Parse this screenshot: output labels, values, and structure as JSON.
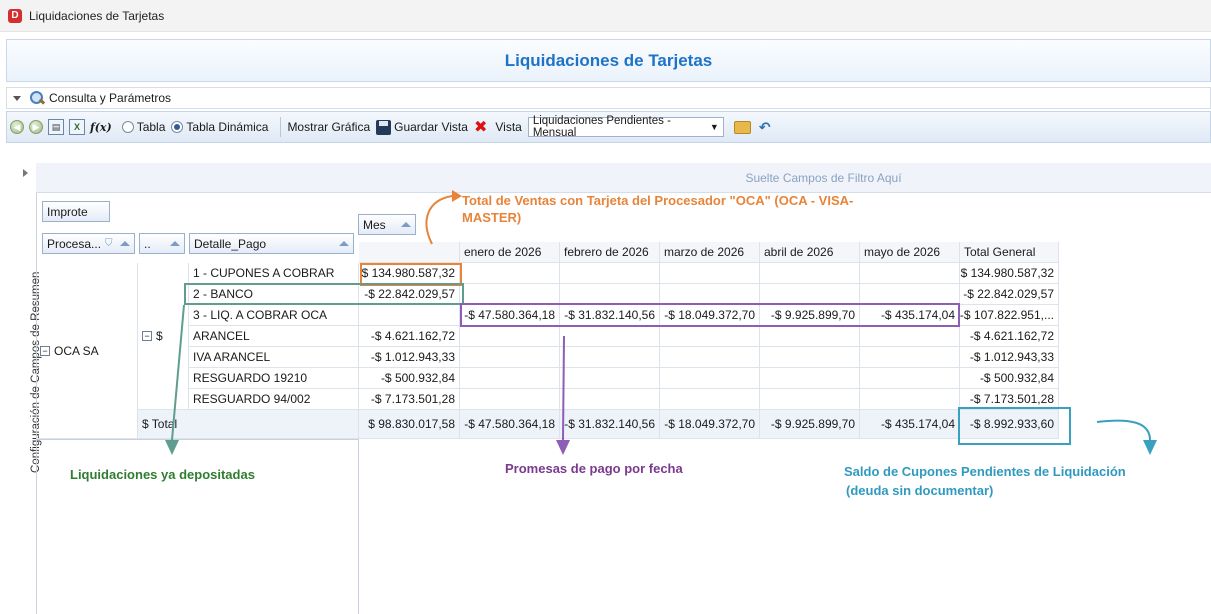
{
  "window": {
    "title": "Liquidaciones de Tarjetas",
    "icon_letter": "D"
  },
  "banner": {
    "title": "Liquidaciones de Tarjetas"
  },
  "consulta": {
    "label": "Consulta y Parámetros"
  },
  "toolbar": {
    "radio_tabla": "Tabla",
    "radio_dinamica": "Tabla Dinámica",
    "mostrar_grafica": "Mostrar Gráfica",
    "guardar_vista": "Guardar Vista",
    "vista_label": "Vista",
    "vista_value": "Liquidaciones Pendientes -Mensual"
  },
  "sidebar": {
    "label": "Configuración de Campos de Resumen"
  },
  "pivot": {
    "filter_hint": "Suelte Campos de Filtro Aquí",
    "data_field": "Improte",
    "column_field": "Mes",
    "row_fields": [
      "Procesa...",
      "..",
      "Detalle_Pago"
    ],
    "columns": [
      "",
      "enero de 2026",
      "febrero de 2026",
      "marzo de 2026",
      "abril de 2026",
      "mayo de 2026",
      "Total General"
    ],
    "group_level1": "OCA SA",
    "group_level2": "$",
    "rows": [
      {
        "label": "1 - CUPONES A COBRAR",
        "values": [
          "$ 134.980.587,32",
          "",
          "",
          "",
          "",
          "",
          "$ 134.980.587,32"
        ]
      },
      {
        "label": "2 - BANCO",
        "values": [
          "-$ 22.842.029,57",
          "",
          "",
          "",
          "",
          "",
          "-$ 22.842.029,57"
        ]
      },
      {
        "label": "3 - LIQ. A COBRAR OCA",
        "values": [
          "",
          "-$ 47.580.364,18",
          "-$ 31.832.140,56",
          "-$ 18.049.372,70",
          "-$ 9.925.899,70",
          "-$ 435.174,04",
          "-$ 107.822.951,..."
        ]
      },
      {
        "label": "ARANCEL",
        "values": [
          "-$ 4.621.162,72",
          "",
          "",
          "",
          "",
          "",
          "-$ 4.621.162,72"
        ]
      },
      {
        "label": "IVA ARANCEL",
        "values": [
          "-$ 1.012.943,33",
          "",
          "",
          "",
          "",
          "",
          "-$ 1.012.943,33"
        ]
      },
      {
        "label": "RESGUARDO 19210",
        "values": [
          "-$ 500.932,84",
          "",
          "",
          "",
          "",
          "",
          "-$ 500.932,84"
        ]
      },
      {
        "label": "RESGUARDO 94/002",
        "values": [
          "-$ 7.173.501,28",
          "",
          "",
          "",
          "",
          "",
          "-$ 7.173.501,28"
        ]
      }
    ],
    "total_label": "$ Total",
    "total_values": [
      "$ 98.830.017,58",
      "-$ 47.580.364,18",
      "-$ 31.832.140,56",
      "-$ 18.049.372,70",
      "-$ 9.925.899,70",
      "-$ 435.174,04",
      "-$ 8.992.933,60"
    ]
  },
  "annotations": {
    "total_ventas": "Total de Ventas con Tarjeta del Procesador \"OCA\" (OCA - VISA- MASTER)",
    "liquidaciones": "Liquidaciones ya depositadas",
    "promesas": "Promesas de pago por fecha",
    "saldo": "Saldo de Cupones Pendientes de Liquidación",
    "saldo_sub": "(deuda sin documentar)",
    "colors": {
      "orange": "#e8843a",
      "green": "#5f9e8f",
      "purple": "#8e5db5",
      "teal": "#3aa0c0"
    }
  }
}
